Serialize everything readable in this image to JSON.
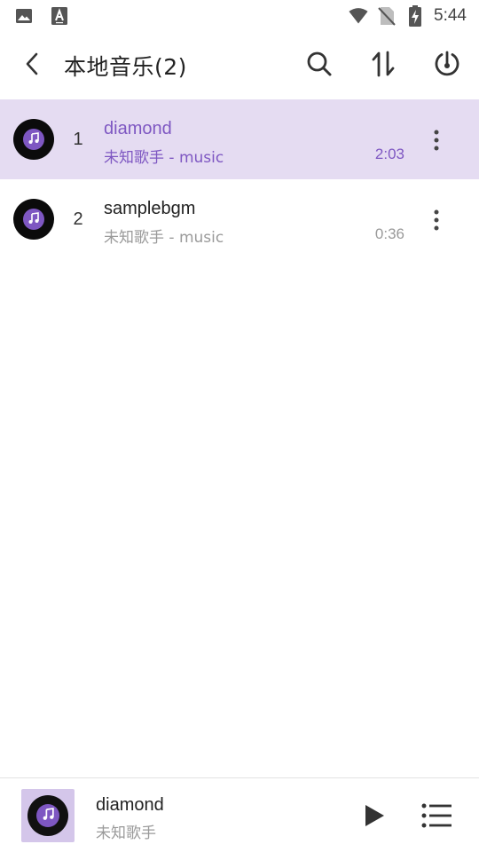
{
  "status_bar": {
    "time": "5:44",
    "icons": [
      "image-icon",
      "text-a-icon",
      "wifi-icon",
      "no-sim-icon",
      "battery-charging-icon"
    ]
  },
  "app_bar": {
    "title": "本地音乐(2)",
    "icons": [
      "back-arrow-icon",
      "search-icon",
      "sort-icon",
      "timer-icon"
    ]
  },
  "songs": [
    {
      "index": "1",
      "title": "diamond",
      "subtitle": "未知歌手 - music",
      "duration": "2:03",
      "active": true
    },
    {
      "index": "2",
      "title": "samplebgm",
      "subtitle": "未知歌手 - music",
      "duration": "0:36",
      "active": false
    }
  ],
  "player": {
    "title": "diamond",
    "artist": "未知歌手",
    "icons": [
      "music-note-icon",
      "play-icon",
      "playlist-icon"
    ]
  },
  "colors": {
    "accent": "#7e57c2",
    "active_row_bg": "#e5dcf2",
    "cover_bg": "#d4c6ea"
  }
}
